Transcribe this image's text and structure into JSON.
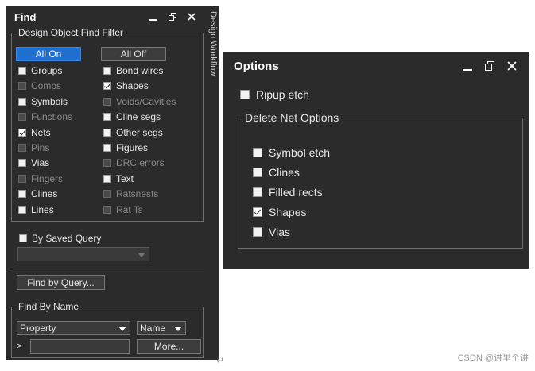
{
  "find_panel": {
    "title": "Find",
    "filter_group": {
      "legend": "Design Object Find Filter",
      "all_on": "All On",
      "all_off": "All Off",
      "items_left": [
        {
          "label": "Groups",
          "checked": false,
          "disabled": false
        },
        {
          "label": "Comps",
          "checked": false,
          "disabled": true
        },
        {
          "label": "Symbols",
          "checked": false,
          "disabled": false
        },
        {
          "label": "Functions",
          "checked": false,
          "disabled": true
        },
        {
          "label": "Nets",
          "checked": true,
          "disabled": false
        },
        {
          "label": "Pins",
          "checked": false,
          "disabled": true
        },
        {
          "label": "Vias",
          "checked": false,
          "disabled": false
        },
        {
          "label": "Fingers",
          "checked": false,
          "disabled": true
        },
        {
          "label": "Clines",
          "checked": false,
          "disabled": false
        },
        {
          "label": "Lines",
          "checked": false,
          "disabled": false
        }
      ],
      "items_right": [
        {
          "label": "Bond wires",
          "checked": false,
          "disabled": false
        },
        {
          "label": "Shapes",
          "checked": true,
          "disabled": false
        },
        {
          "label": "Voids/Cavities",
          "checked": false,
          "disabled": true
        },
        {
          "label": "Cline segs",
          "checked": false,
          "disabled": false
        },
        {
          "label": "Other segs",
          "checked": false,
          "disabled": false
        },
        {
          "label": "Figures",
          "checked": false,
          "disabled": false
        },
        {
          "label": "DRC errors",
          "checked": false,
          "disabled": true
        },
        {
          "label": "Text",
          "checked": false,
          "disabled": false
        },
        {
          "label": "Ratsnests",
          "checked": false,
          "disabled": true
        },
        {
          "label": "Rat Ts",
          "checked": false,
          "disabled": true
        }
      ],
      "saved_query_label": "By Saved Query"
    },
    "find_by_query_label": "Find by Query...",
    "find_by_name": {
      "legend": "Find By Name",
      "property_value": "Property",
      "name_value": "Name",
      "prompt": ">",
      "more_label": "More..."
    }
  },
  "side_tab": {
    "label": "Design Workflow"
  },
  "options_panel": {
    "title": "Options",
    "ripup_etch": {
      "label": "Ripup etch",
      "checked": false
    },
    "delete_net_group": {
      "legend": "Delete Net Options",
      "items": [
        {
          "label": "Symbol etch",
          "checked": false
        },
        {
          "label": "Clines",
          "checked": false
        },
        {
          "label": "Filled rects",
          "checked": false
        },
        {
          "label": "Shapes",
          "checked": true
        },
        {
          "label": "Vias",
          "checked": false
        }
      ]
    }
  },
  "watermark": "CSDN @讲里个讲",
  "colors": {
    "panel_bg": "#2b2b2b",
    "accent": "#1f6fd1",
    "border": "#6e6e6e"
  }
}
